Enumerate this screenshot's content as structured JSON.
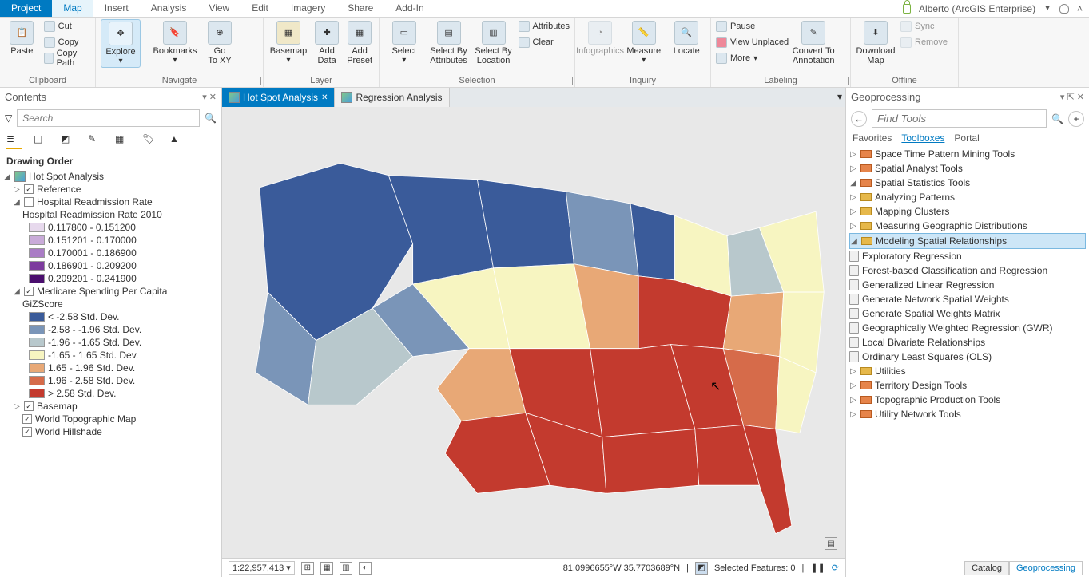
{
  "user": "Alberto (ArcGIS Enterprise)",
  "menu_tabs": [
    "Project",
    "Map",
    "Insert",
    "Analysis",
    "View",
    "Edit",
    "Imagery",
    "Share",
    "Add-In"
  ],
  "ribbon": {
    "clipboard": {
      "label": "Clipboard",
      "paste": "Paste",
      "cut": "Cut",
      "copy": "Copy",
      "copypath": "Copy Path"
    },
    "navigate": {
      "label": "Navigate",
      "explore": "Explore",
      "bookmarks": "Bookmarks",
      "goto": "Go\nTo XY"
    },
    "layer": {
      "label": "Layer",
      "basemap": "Basemap",
      "adddata": "Add\nData",
      "addpreset": "Add\nPreset"
    },
    "selection": {
      "label": "Selection",
      "select": "Select",
      "byattr": "Select By\nAttributes",
      "byloc": "Select By\nLocation",
      "attributes": "Attributes",
      "clear": "Clear"
    },
    "inquiry": {
      "label": "Inquiry",
      "info": "Infographics",
      "measure": "Measure",
      "locate": "Locate"
    },
    "labeling": {
      "label": "Labeling",
      "pause": "Pause",
      "unplaced": "View Unplaced",
      "more": "More",
      "convert": "Convert To\nAnnotation"
    },
    "offline": {
      "label": "Offline",
      "download": "Download\nMap",
      "sync": "Sync",
      "remove": "Remove"
    }
  },
  "contents": {
    "title": "Contents",
    "search_placeholder": "Search",
    "drawing_order": "Drawing Order",
    "map_name": "Hot Spot Analysis",
    "reference": "Reference",
    "layer1": {
      "name": "Hospital Readmission Rate",
      "field": "Hospital Readmission Rate 2010",
      "classes": [
        {
          "c": "#e7d9ed",
          "l": "0.117800 - 0.151200"
        },
        {
          "c": "#c9abd9",
          "l": "0.151201 - 0.170000"
        },
        {
          "c": "#a97cc5",
          "l": "0.170001 - 0.186900"
        },
        {
          "c": "#7d3b9e",
          "l": "0.186901 - 0.209200"
        },
        {
          "c": "#4a0e6e",
          "l": "0.209201 - 0.241900"
        }
      ]
    },
    "layer2": {
      "name": "Medicare Spending Per Capita",
      "field": "GiZScore",
      "classes": [
        {
          "c": "#3a5b9a",
          "l": "< -2.58 Std. Dev."
        },
        {
          "c": "#7a95b8",
          "l": "-2.58 - -1.96 Std. Dev."
        },
        {
          "c": "#b8c8cc",
          "l": "-1.96 - -1.65 Std. Dev."
        },
        {
          "c": "#f7f5c1",
          "l": "-1.65 - 1.65 Std. Dev."
        },
        {
          "c": "#e8a876",
          "l": "1.65 - 1.96 Std. Dev."
        },
        {
          "c": "#d66b4a",
          "l": "1.96 - 2.58 Std. Dev."
        },
        {
          "c": "#c33a2e",
          "l": "> 2.58 Std. Dev."
        }
      ]
    },
    "basemap": "Basemap",
    "base1": "World Topographic Map",
    "base2": "World Hillshade"
  },
  "map_tabs": [
    {
      "name": "Hot Spot Analysis",
      "active": true
    },
    {
      "name": "Regression Analysis",
      "active": false
    }
  ],
  "status": {
    "scale": "1:22,957,413",
    "coord": "81.0996655°W 35.7703689°N",
    "selected": "Selected Features: 0"
  },
  "gp": {
    "title": "Geoprocessing",
    "search_placeholder": "Find Tools",
    "tabs": [
      "Favorites",
      "Toolboxes",
      "Portal"
    ],
    "toolboxes": [
      "Space Time Pattern Mining Tools",
      "Spatial Analyst Tools",
      "Spatial Statistics Tools"
    ],
    "toolsets": [
      "Analyzing Patterns",
      "Mapping Clusters",
      "Measuring Geographic Distributions",
      "Modeling Spatial Relationships"
    ],
    "tools": [
      "Exploratory Regression",
      "Forest-based Classification and Regression",
      "Generalized Linear Regression",
      "Generate Network Spatial Weights",
      "Generate Spatial Weights Matrix",
      "Geographically Weighted Regression (GWR)",
      "Local Bivariate Relationships",
      "Ordinary Least Squares (OLS)"
    ],
    "utilities": "Utilities",
    "more_tbx": [
      "Territory Design Tools",
      "Topographic Production Tools",
      "Utility Network Tools"
    ],
    "bottom_tabs": [
      "Catalog",
      "Geoprocessing"
    ]
  }
}
